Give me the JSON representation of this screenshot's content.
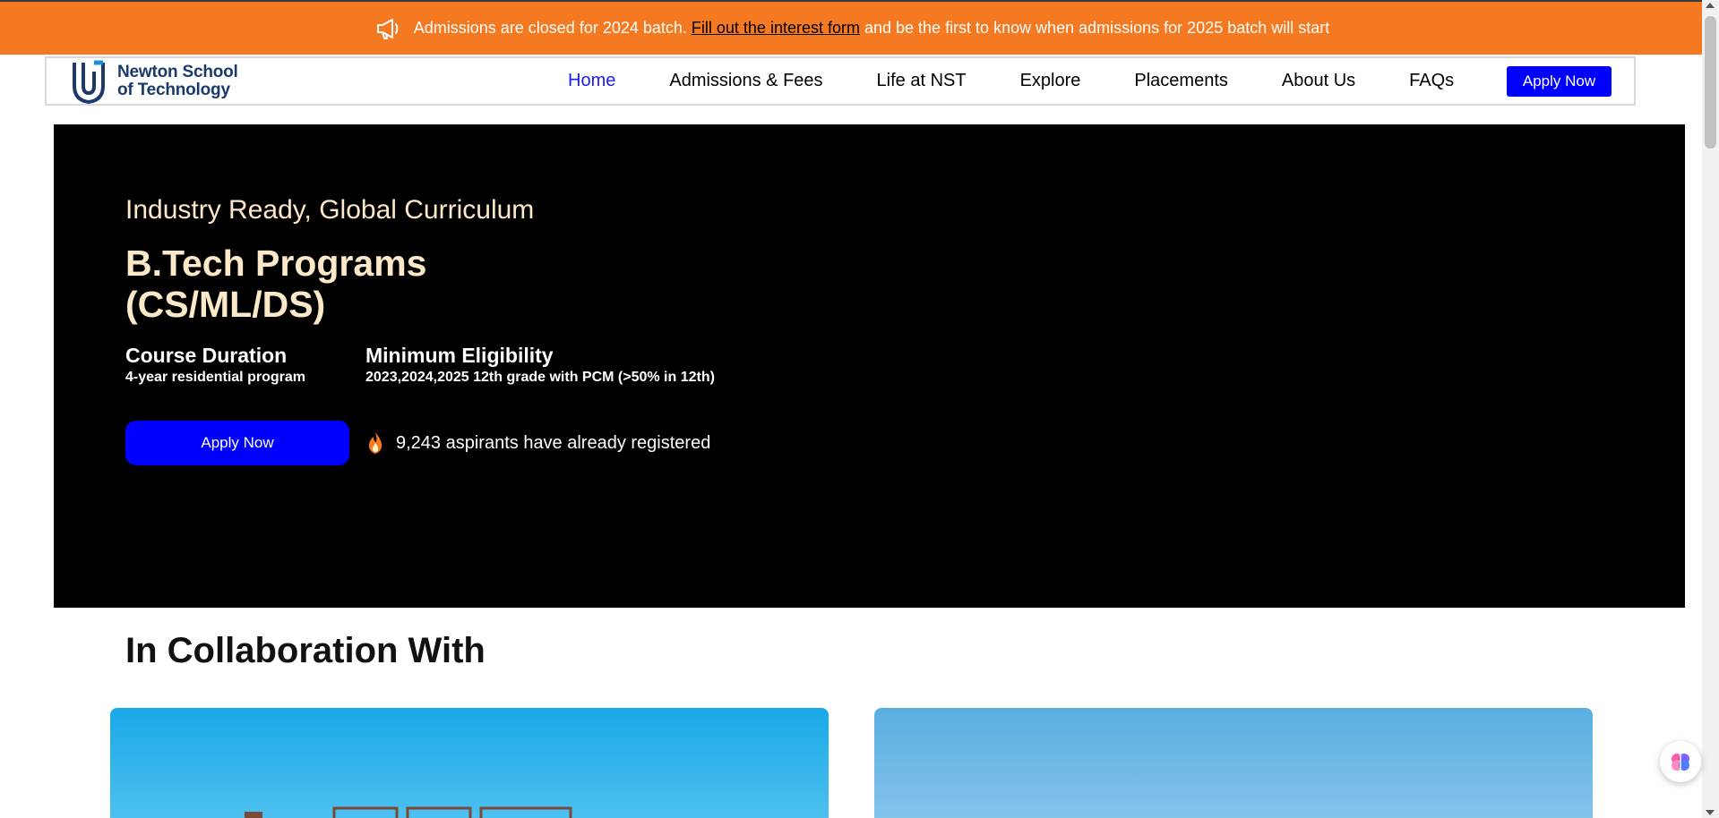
{
  "banner": {
    "icon": "megaphone-icon",
    "text_before": "Admissions are closed for 2024 batch.",
    "link_text": "Fill out the interest form",
    "text_after": "and be the first to know when admissions for 2025 batch will start",
    "bg_color": "#f47920"
  },
  "nav": {
    "logo_line1": "Newton School",
    "logo_line2": "of Technology",
    "links": [
      {
        "label": "Home",
        "active": true
      },
      {
        "label": "Admissions & Fees"
      },
      {
        "label": "Life at NST"
      },
      {
        "label": "Explore"
      },
      {
        "label": "Placements"
      },
      {
        "label": "About Us"
      },
      {
        "label": "FAQs"
      }
    ],
    "apply_label": "Apply Now",
    "accent_color": "#0000ff"
  },
  "hero": {
    "tagline": "Industry Ready, Global Curriculum",
    "title_line1": "B.Tech Programs",
    "title_line2": "(CS/ML/DS)",
    "duration_label": "Course Duration",
    "duration_value": "4-year residential program",
    "eligibility_label": "Minimum Eligibility",
    "eligibility_value": "2023,2024,2025 12th grade with PCM (>50% in 12th)",
    "apply_label": "Apply Now",
    "aspirants_text": "9,243 aspirants have already registered",
    "aspirants_icon": "fire-icon"
  },
  "collaboration": {
    "heading": "In Collaboration With"
  }
}
